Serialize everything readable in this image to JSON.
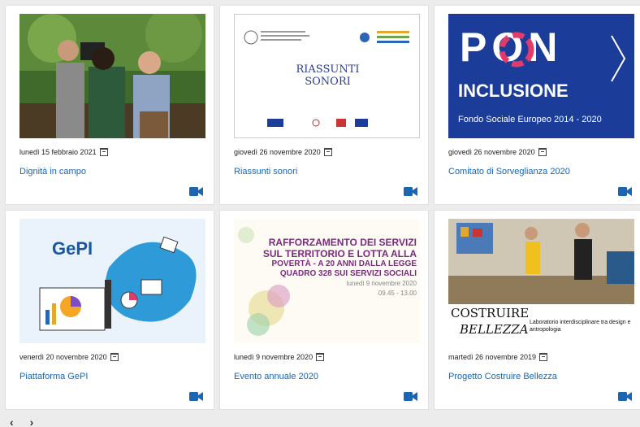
{
  "cards": [
    {
      "date": "lunedì 15 febbraio 2021",
      "title": "Dignità in campo"
    },
    {
      "date": "giovedì 26 novembre 2020",
      "title": "Riassunti sonori",
      "thumb_text": [
        "RIASSUNTI",
        "SONORI"
      ],
      "thumb_logo": "PON INCLUSIONE"
    },
    {
      "date": "giovedì 26 novembre 2020",
      "title": "Comitato di Sorveglianza 2020",
      "thumb_text": [
        "PON",
        "INCLUSIONE",
        "Fondo Sociale Europeo 2014 - 2020"
      ]
    },
    {
      "date": "venerdì 20 novembre 2020",
      "title": "Piattaforma GePI",
      "thumb_text": [
        "GePI"
      ]
    },
    {
      "date": "lunedì 9 novembre 2020",
      "title": "Evento annuale 2020",
      "thumb_text": [
        "RAFFORZAMENTO DEI SERVIZI",
        "SUL TERRITORIO E LOTTA ALLA",
        "POVERTÀ - A 20 ANNI DALLA LEGGE",
        "QUADRO 328 SUI SERVIZI SOCIALI",
        "lunedì 9 novembre 2020",
        "09.45 - 13.00"
      ]
    },
    {
      "date": "martedì 26 novembre 2019",
      "title": "Progetto Costruire Bellezza",
      "thumb_text": [
        "COSTRUIRE",
        "BELLEZZA",
        "Laboratorio interdisciplinare tra design e antropologia"
      ]
    }
  ],
  "pager": {
    "prev": "‹",
    "next": "›"
  },
  "colors": {
    "link": "#1a66b3",
    "pon_blue": "#1b3c99",
    "evento_purple": "#7a2b7d"
  }
}
